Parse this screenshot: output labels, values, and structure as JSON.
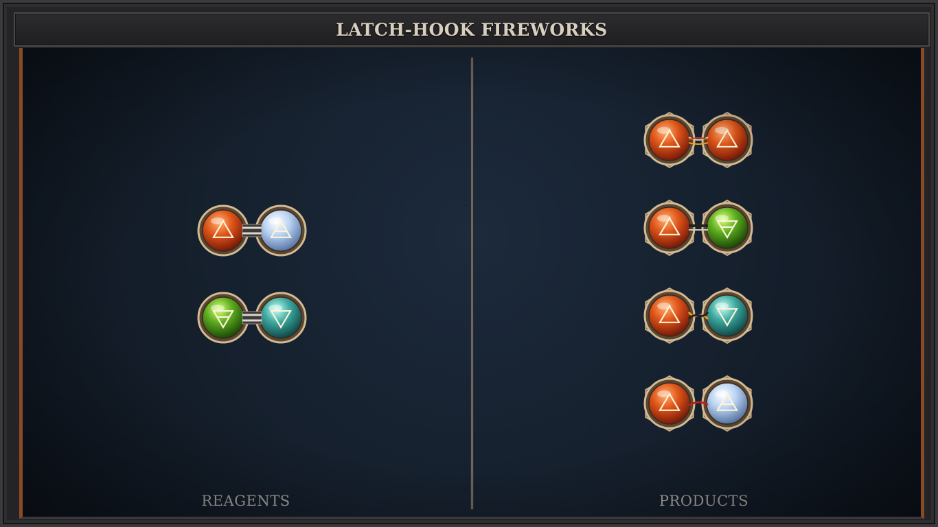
{
  "title": "LATCH-HOOK FIREWORKS",
  "sections": {
    "reagents_label": "REAGENTS",
    "products_label": "PRODUCTS"
  },
  "colors": {
    "fire": "#e0561a",
    "air": "#b9d3f2",
    "earth": "#5fae20",
    "water": "#3ea9a0",
    "frame_accent": "#8a4a25"
  },
  "reagents": [
    {
      "left": {
        "element": "fire",
        "symbol": "fire-triangle-icon"
      },
      "right": {
        "element": "air",
        "symbol": "air-triangle-icon"
      },
      "bond": "double",
      "frame": "round"
    },
    {
      "left": {
        "element": "earth",
        "symbol": "earth-triangle-icon"
      },
      "right": {
        "element": "water",
        "symbol": "water-triangle-icon"
      },
      "bond": "double",
      "frame": "round"
    }
  ],
  "products": [
    {
      "left": {
        "element": "fire",
        "symbol": "fire-triangle-icon"
      },
      "right": {
        "element": "fire",
        "symbol": "fire-triangle-icon"
      },
      "bond": "triple-colored",
      "frame": "hex"
    },
    {
      "left": {
        "element": "fire",
        "symbol": "fire-triangle-icon"
      },
      "right": {
        "element": "earth",
        "symbol": "earth-triangle-icon"
      },
      "bond": "double-dark",
      "frame": "hex"
    },
    {
      "left": {
        "element": "fire",
        "symbol": "fire-triangle-icon"
      },
      "right": {
        "element": "water",
        "symbol": "water-triangle-icon"
      },
      "bond": "twisted",
      "frame": "hex"
    },
    {
      "left": {
        "element": "fire",
        "symbol": "fire-triangle-icon"
      },
      "right": {
        "element": "air",
        "symbol": "air-triangle-icon"
      },
      "bond": "single-red",
      "frame": "hex"
    }
  ]
}
